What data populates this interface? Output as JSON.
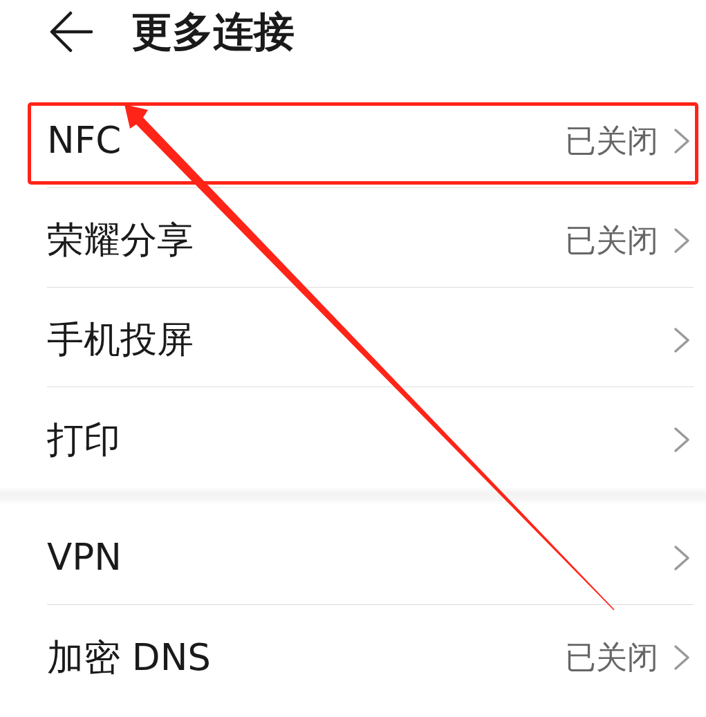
{
  "header": {
    "title": "更多连接"
  },
  "sections": [
    {
      "items": [
        {
          "label": "NFC",
          "value": "已关闭",
          "highlighted": true
        },
        {
          "label": "荣耀分享",
          "value": "已关闭",
          "highlighted": false
        },
        {
          "label": "手机投屏",
          "highlighted": false
        },
        {
          "label": "打印",
          "highlighted": false
        }
      ]
    },
    {
      "items": [
        {
          "label": "VPN",
          "highlighted": false
        },
        {
          "label": "加密 DNS",
          "value": "已关闭",
          "highlighted": false
        }
      ]
    }
  ]
}
